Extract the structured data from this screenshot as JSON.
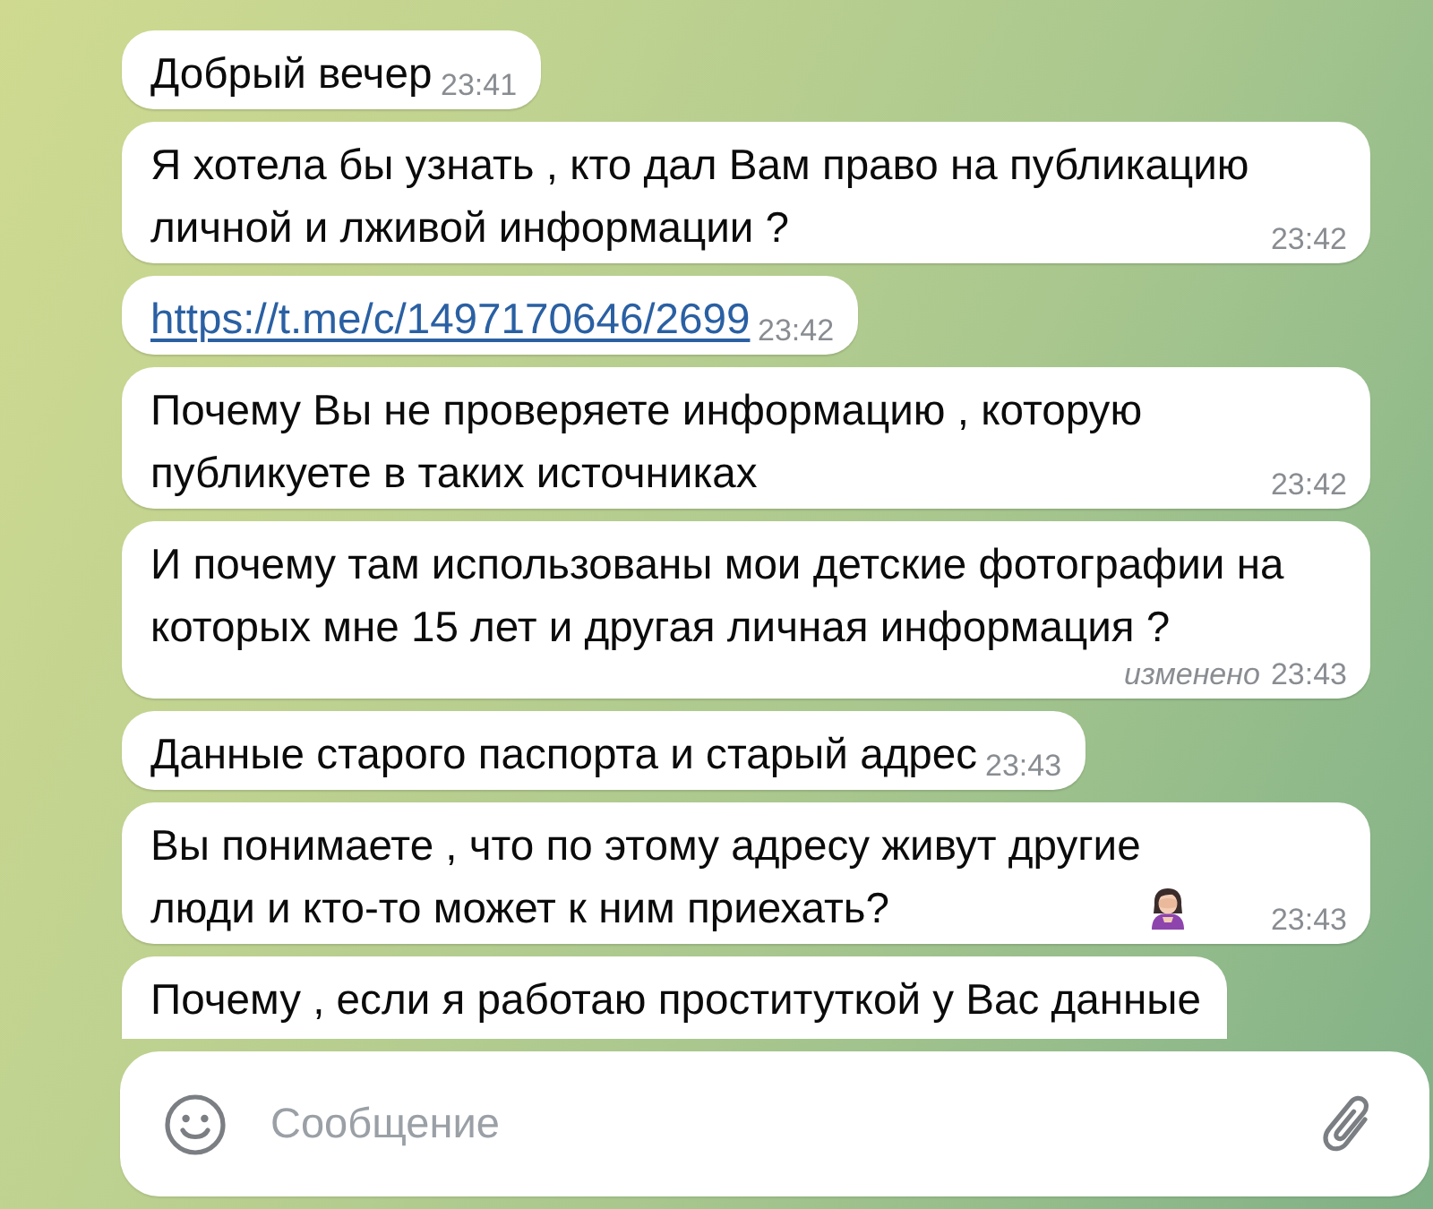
{
  "messages": [
    {
      "kind": "text",
      "text": "Добрый вечер",
      "time": "23:41"
    },
    {
      "kind": "text",
      "text": "Я хотела бы узнать , кто дал Вам право на публикацию личной и лживой информации ?",
      "time": "23:42"
    },
    {
      "kind": "link",
      "text": "https://t.me/c/1497170646/2699",
      "time": "23:42"
    },
    {
      "kind": "text",
      "text": "Почему Вы не проверяете информацию , которую публикуете в таких источниках",
      "time": "23:42"
    },
    {
      "kind": "text",
      "text": "И почему там использованы мои детские фотографии на которых мне 15 лет и другая личная информация ?",
      "edited_label": "изменено",
      "time": "23:43"
    },
    {
      "kind": "text",
      "text": "Данные старого паспорта и старый адрес",
      "time": "23:43"
    },
    {
      "kind": "text",
      "text": "Вы понимаете , что по этому адресу живут другие люди и кто-то может к ним приехать?",
      "emoji": true,
      "time": "23:43"
    },
    {
      "kind": "text",
      "text": "Почему , если я работаю проституткой у Вас данные"
    }
  ],
  "composer": {
    "placeholder": "Сообщение"
  }
}
